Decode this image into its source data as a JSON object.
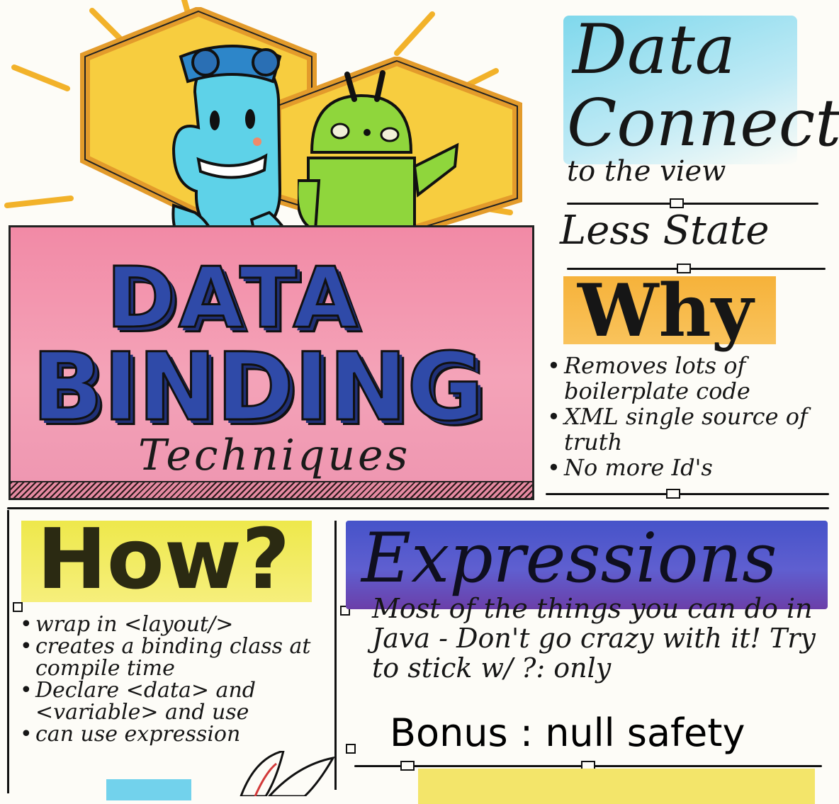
{
  "title": {
    "line1": "DATA",
    "line2": "BINDING",
    "line3": "Techniques"
  },
  "data_connect": {
    "heading1": "Data",
    "heading2": "Connect",
    "subheading": "to the view",
    "less_state": "Less State"
  },
  "why": {
    "heading": "Why",
    "items": [
      "Removes lots of boilerplate code",
      "XML single source of truth",
      "No more Id's"
    ]
  },
  "how": {
    "heading": "How?",
    "items": [
      "wrap in <layout/>",
      "creates a binding class at compile time",
      "Declare <data> and <variable> and use",
      "can use expression"
    ]
  },
  "expressions": {
    "heading": "Expressions",
    "body": "Most of the things you can do in Java - Don't go crazy with it! Try to stick w/ ?: only",
    "bonus": "Bonus : null safety"
  },
  "colors": {
    "sun": "#f7c93b",
    "banner": "#f29ab2",
    "title_blue": "#2f4aa8",
    "connect_bg": "#7fd8ec",
    "why_bg": "#f6b23a",
    "how_bg": "#eee84b",
    "expressions_bg": "#4653c9"
  }
}
